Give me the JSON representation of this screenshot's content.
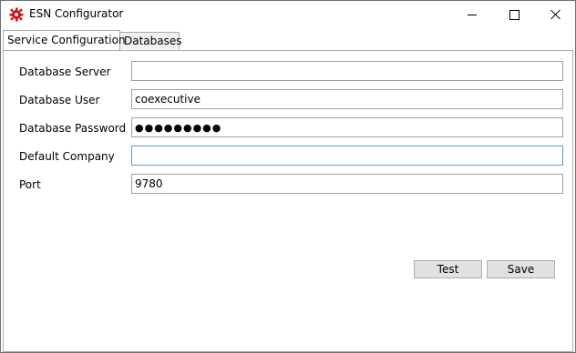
{
  "window": {
    "title": "ESN Configurator",
    "icon": "gear-icon",
    "accent_color": "#cc1111"
  },
  "tabs": [
    {
      "label": "Service Configuration",
      "active": true
    },
    {
      "label": "Databases",
      "active": false
    }
  ],
  "form": {
    "database_server": {
      "label": "Database Server",
      "value": ""
    },
    "database_user": {
      "label": "Database User",
      "value": "coexecutive"
    },
    "database_password": {
      "label": "Database Password",
      "masked_value": "●●●●●●●●●"
    },
    "default_company": {
      "label": "Default Company",
      "value": ""
    },
    "port": {
      "label": "Port",
      "value": "9780"
    }
  },
  "buttons": {
    "test": "Test",
    "save": "Save"
  }
}
